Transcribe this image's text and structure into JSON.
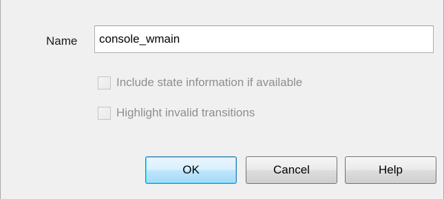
{
  "name_field": {
    "label": "Name",
    "value": "console_wmain"
  },
  "options": [
    {
      "label": "Include state information if available",
      "checked": false,
      "enabled": false
    },
    {
      "label": "Highlight invalid transitions",
      "checked": false,
      "enabled": false
    }
  ],
  "buttons": {
    "ok": "OK",
    "cancel": "Cancel",
    "help": "Help"
  }
}
